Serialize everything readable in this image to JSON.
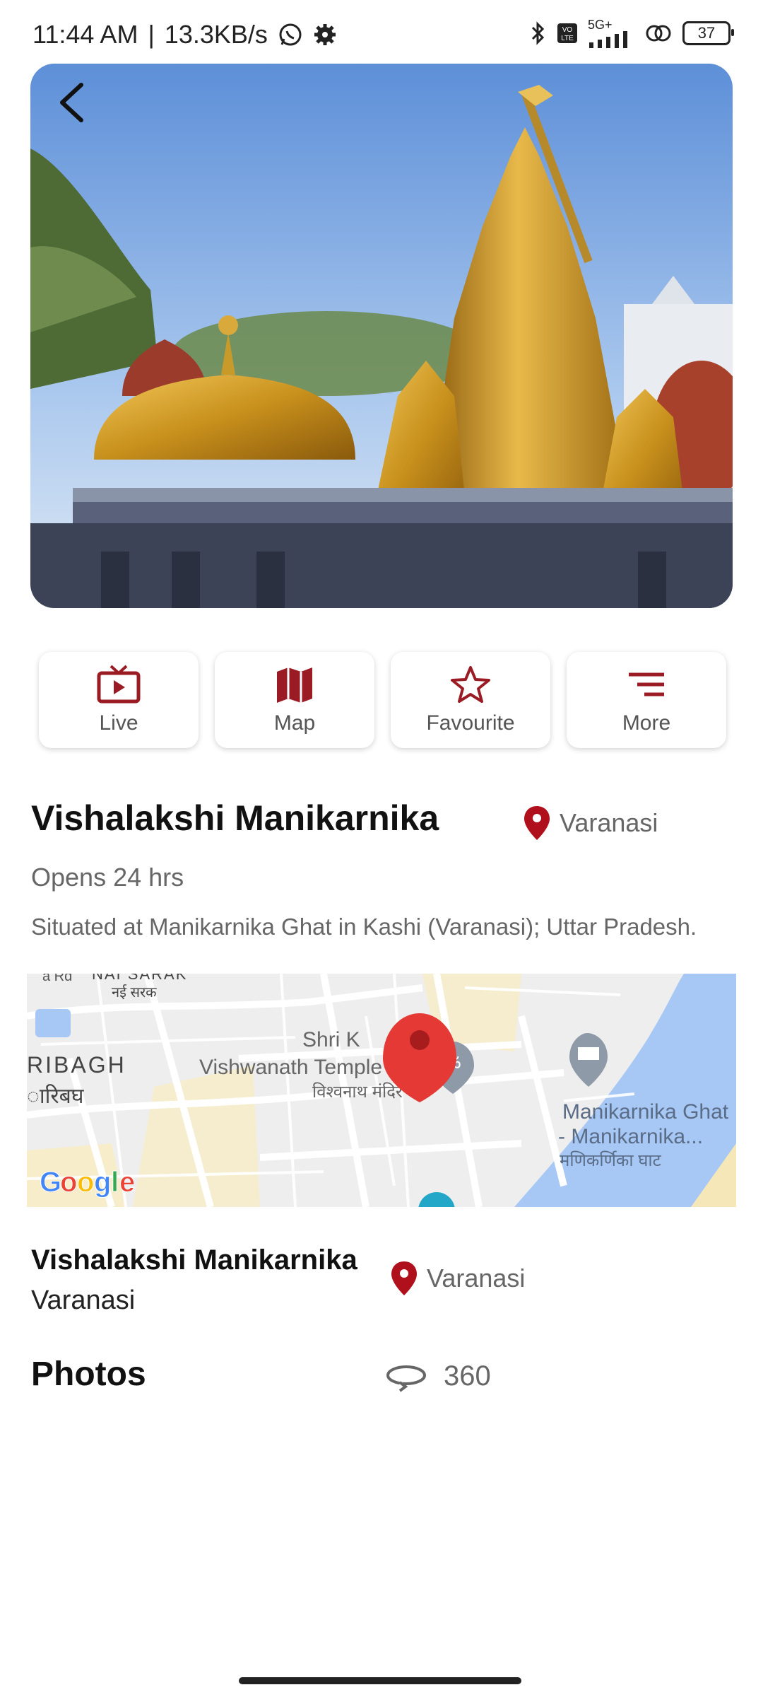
{
  "status_bar": {
    "time": "11:44 AM",
    "network_speed": "13.3KB/s",
    "network_type": "5G+",
    "battery": "37"
  },
  "hero": {
    "image": "golden temple domes photo"
  },
  "actions": [
    {
      "label": "Live",
      "icon": "tv-icon"
    },
    {
      "label": "Map",
      "icon": "map-icon"
    },
    {
      "label": "Favourite",
      "icon": "star-icon"
    },
    {
      "label": "More",
      "icon": "menu-lines-icon"
    }
  ],
  "temple": {
    "name": "Vishalakshi Manikarnika",
    "location": "Varanasi",
    "hours": "Opens 24 hrs",
    "description": "Situated at Manikarnika Ghat in Kashi (Varanasi); Uttar Pradesh."
  },
  "map": {
    "labels": {
      "nai_sarak": "NAI SARAK",
      "nai_sarak_hi": "नई सरक",
      "ribagh": "RIBAGH",
      "ribagh_hi": "ारिबघ",
      "temple_line1": "Shri K",
      "temple_line2": "Vishwanath Temple",
      "temple_hi": "विश्वनाथ मंदिर",
      "ghat_line1": "Manikarnika Ghat",
      "ghat_line2": "- Manikarnika...",
      "ghat_hi": "मणिकर्णिका घाट",
      "provider": "Google",
      "edge_label": "a Rd"
    }
  },
  "summary": {
    "name": "Vishalakshi Manikarnika",
    "city": "Varanasi",
    "location": "Varanasi"
  },
  "photos": {
    "heading": "Photos",
    "view_label": "360"
  },
  "colors": {
    "accent": "#9b1b24",
    "text_muted": "#666666",
    "map_water": "#a7c7f5",
    "map_pin": "#e53935"
  }
}
